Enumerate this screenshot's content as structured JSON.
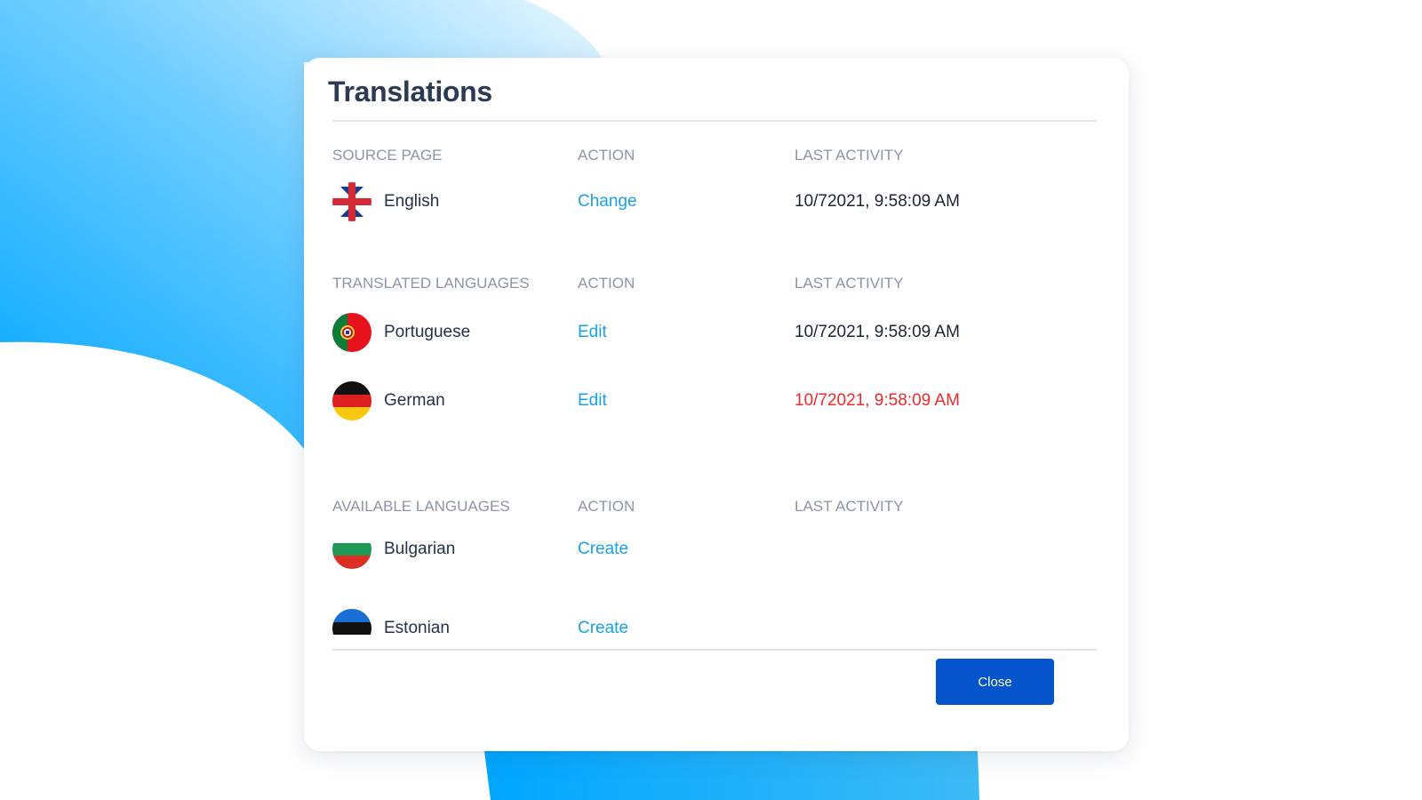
{
  "dialog": {
    "title": "Translations",
    "close_label": "Close"
  },
  "colors": {
    "link": "#16a2e6",
    "warning": "#ef2a2a",
    "primary_button": "#0654cc",
    "background_accent": "#00a6ff"
  },
  "source": {
    "headers": [
      "SOURCE PAGE",
      "ACTION",
      "LAST ACTIVITY"
    ],
    "rows": [
      {
        "flag": "uk-flag-icon",
        "language": "English",
        "action": "Change",
        "last_activity": "10/72021, 9:58:09 AM"
      }
    ]
  },
  "translated": {
    "headers": [
      "TRANSLATED LANGUAGES",
      "ACTION",
      "LAST ACTIVITY"
    ],
    "rows": [
      {
        "flag": "portugal-flag-icon",
        "language": "Portuguese",
        "action": "Edit",
        "last_activity": "10/72021, 9:58:09 AM"
      },
      {
        "flag": "germany-flag-icon",
        "language": "German",
        "action": "Edit",
        "last_activity": "10/72021, 9:58:09 AM",
        "status": "warning"
      }
    ]
  },
  "available": {
    "headers": [
      "AVAILABLE LANGUAGES",
      "ACTION",
      "LAST ACTIVITY"
    ],
    "rows": [
      {
        "flag": "bulgaria-flag-icon",
        "language": "Bulgarian",
        "action": "Create"
      },
      {
        "flag": "estonia-flag-icon",
        "language": "Estonian",
        "action": "Create"
      }
    ]
  }
}
